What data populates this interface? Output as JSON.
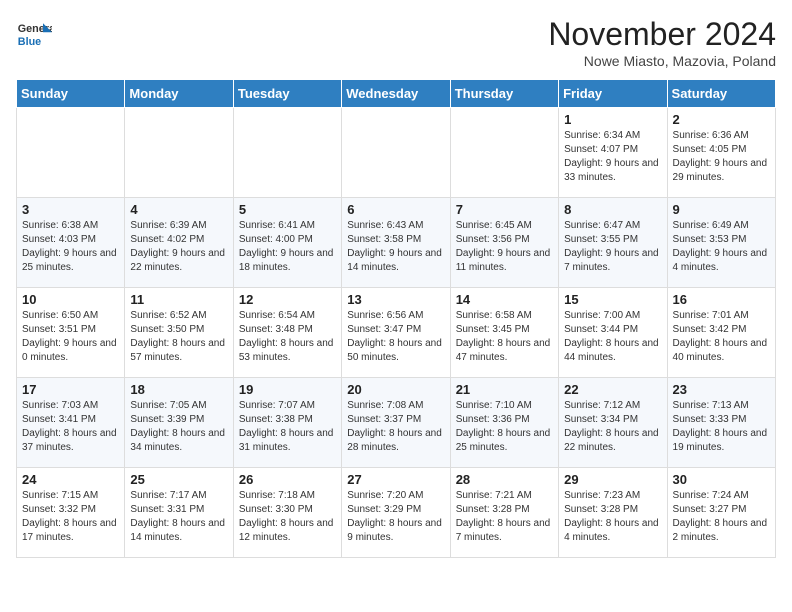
{
  "logo": {
    "general": "General",
    "blue": "Blue"
  },
  "title": "November 2024",
  "subtitle": "Nowe Miasto, Mazovia, Poland",
  "days_of_week": [
    "Sunday",
    "Monday",
    "Tuesday",
    "Wednesday",
    "Thursday",
    "Friday",
    "Saturday"
  ],
  "weeks": [
    [
      {
        "day": "",
        "info": ""
      },
      {
        "day": "",
        "info": ""
      },
      {
        "day": "",
        "info": ""
      },
      {
        "day": "",
        "info": ""
      },
      {
        "day": "",
        "info": ""
      },
      {
        "day": "1",
        "info": "Sunrise: 6:34 AM\nSunset: 4:07 PM\nDaylight: 9 hours and 33 minutes."
      },
      {
        "day": "2",
        "info": "Sunrise: 6:36 AM\nSunset: 4:05 PM\nDaylight: 9 hours and 29 minutes."
      }
    ],
    [
      {
        "day": "3",
        "info": "Sunrise: 6:38 AM\nSunset: 4:03 PM\nDaylight: 9 hours and 25 minutes."
      },
      {
        "day": "4",
        "info": "Sunrise: 6:39 AM\nSunset: 4:02 PM\nDaylight: 9 hours and 22 minutes."
      },
      {
        "day": "5",
        "info": "Sunrise: 6:41 AM\nSunset: 4:00 PM\nDaylight: 9 hours and 18 minutes."
      },
      {
        "day": "6",
        "info": "Sunrise: 6:43 AM\nSunset: 3:58 PM\nDaylight: 9 hours and 14 minutes."
      },
      {
        "day": "7",
        "info": "Sunrise: 6:45 AM\nSunset: 3:56 PM\nDaylight: 9 hours and 11 minutes."
      },
      {
        "day": "8",
        "info": "Sunrise: 6:47 AM\nSunset: 3:55 PM\nDaylight: 9 hours and 7 minutes."
      },
      {
        "day": "9",
        "info": "Sunrise: 6:49 AM\nSunset: 3:53 PM\nDaylight: 9 hours and 4 minutes."
      }
    ],
    [
      {
        "day": "10",
        "info": "Sunrise: 6:50 AM\nSunset: 3:51 PM\nDaylight: 9 hours and 0 minutes."
      },
      {
        "day": "11",
        "info": "Sunrise: 6:52 AM\nSunset: 3:50 PM\nDaylight: 8 hours and 57 minutes."
      },
      {
        "day": "12",
        "info": "Sunrise: 6:54 AM\nSunset: 3:48 PM\nDaylight: 8 hours and 53 minutes."
      },
      {
        "day": "13",
        "info": "Sunrise: 6:56 AM\nSunset: 3:47 PM\nDaylight: 8 hours and 50 minutes."
      },
      {
        "day": "14",
        "info": "Sunrise: 6:58 AM\nSunset: 3:45 PM\nDaylight: 8 hours and 47 minutes."
      },
      {
        "day": "15",
        "info": "Sunrise: 7:00 AM\nSunset: 3:44 PM\nDaylight: 8 hours and 44 minutes."
      },
      {
        "day": "16",
        "info": "Sunrise: 7:01 AM\nSunset: 3:42 PM\nDaylight: 8 hours and 40 minutes."
      }
    ],
    [
      {
        "day": "17",
        "info": "Sunrise: 7:03 AM\nSunset: 3:41 PM\nDaylight: 8 hours and 37 minutes."
      },
      {
        "day": "18",
        "info": "Sunrise: 7:05 AM\nSunset: 3:39 PM\nDaylight: 8 hours and 34 minutes."
      },
      {
        "day": "19",
        "info": "Sunrise: 7:07 AM\nSunset: 3:38 PM\nDaylight: 8 hours and 31 minutes."
      },
      {
        "day": "20",
        "info": "Sunrise: 7:08 AM\nSunset: 3:37 PM\nDaylight: 8 hours and 28 minutes."
      },
      {
        "day": "21",
        "info": "Sunrise: 7:10 AM\nSunset: 3:36 PM\nDaylight: 8 hours and 25 minutes."
      },
      {
        "day": "22",
        "info": "Sunrise: 7:12 AM\nSunset: 3:34 PM\nDaylight: 8 hours and 22 minutes."
      },
      {
        "day": "23",
        "info": "Sunrise: 7:13 AM\nSunset: 3:33 PM\nDaylight: 8 hours and 19 minutes."
      }
    ],
    [
      {
        "day": "24",
        "info": "Sunrise: 7:15 AM\nSunset: 3:32 PM\nDaylight: 8 hours and 17 minutes."
      },
      {
        "day": "25",
        "info": "Sunrise: 7:17 AM\nSunset: 3:31 PM\nDaylight: 8 hours and 14 minutes."
      },
      {
        "day": "26",
        "info": "Sunrise: 7:18 AM\nSunset: 3:30 PM\nDaylight: 8 hours and 12 minutes."
      },
      {
        "day": "27",
        "info": "Sunrise: 7:20 AM\nSunset: 3:29 PM\nDaylight: 8 hours and 9 minutes."
      },
      {
        "day": "28",
        "info": "Sunrise: 7:21 AM\nSunset: 3:28 PM\nDaylight: 8 hours and 7 minutes."
      },
      {
        "day": "29",
        "info": "Sunrise: 7:23 AM\nSunset: 3:28 PM\nDaylight: 8 hours and 4 minutes."
      },
      {
        "day": "30",
        "info": "Sunrise: 7:24 AM\nSunset: 3:27 PM\nDaylight: 8 hours and 2 minutes."
      }
    ]
  ]
}
